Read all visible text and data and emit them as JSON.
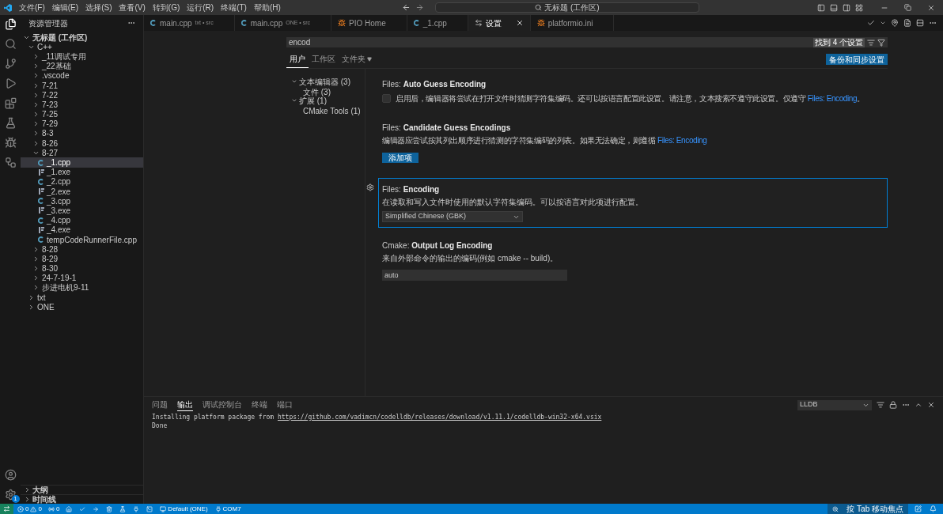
{
  "title_bar": {
    "menu": [
      "文件(F)",
      "编辑(E)",
      "选择(S)",
      "查看(V)",
      "转到(G)",
      "运行(R)",
      "终端(T)",
      "帮助(H)"
    ],
    "command_center": "无标题 (工作区)"
  },
  "activity_bar": {
    "settings_badge": "1"
  },
  "sidebar": {
    "title": "资源管理器",
    "tree": [
      {
        "label": "无标题 (工作区)",
        "kind": "workspace",
        "expanded": true,
        "selected": false,
        "children": [
          {
            "label": "C++",
            "kind": "folder",
            "expanded": true,
            "selected": false,
            "children": [
              {
                "label": "_11调试专用",
                "kind": "folder",
                "expanded": false,
                "selected": false
              },
              {
                "label": "_22基础",
                "kind": "folder",
                "expanded": false,
                "selected": false
              },
              {
                "label": ".vscode",
                "kind": "folder",
                "expanded": false,
                "selected": false
              },
              {
                "label": "7-21",
                "kind": "folder",
                "expanded": false,
                "selected": false
              },
              {
                "label": "7-22",
                "kind": "folder",
                "expanded": false,
                "selected": false
              },
              {
                "label": "7-23",
                "kind": "folder",
                "expanded": false,
                "selected": false
              },
              {
                "label": "7-25",
                "kind": "folder",
                "expanded": false,
                "selected": false
              },
              {
                "label": "7-29",
                "kind": "folder",
                "expanded": false,
                "selected": false
              },
              {
                "label": "8-3",
                "kind": "folder",
                "expanded": false,
                "selected": false
              },
              {
                "label": "8-26",
                "kind": "folder",
                "expanded": false,
                "selected": false
              },
              {
                "label": "8-27",
                "kind": "folder",
                "expanded": true,
                "selected": false,
                "children": [
                  {
                    "label": "_1.cpp",
                    "kind": "cpp",
                    "selected": true
                  },
                  {
                    "label": "_1.exe",
                    "kind": "exe",
                    "selected": false
                  },
                  {
                    "label": "_2.cpp",
                    "kind": "cpp",
                    "selected": false
                  },
                  {
                    "label": "_2.exe",
                    "kind": "exe",
                    "selected": false
                  },
                  {
                    "label": "_3.cpp",
                    "kind": "cpp",
                    "selected": false
                  },
                  {
                    "label": "_3.exe",
                    "kind": "exe",
                    "selected": false
                  },
                  {
                    "label": "_4.cpp",
                    "kind": "cpp",
                    "selected": false
                  },
                  {
                    "label": "_4.exe",
                    "kind": "exe",
                    "selected": false
                  },
                  {
                    "label": "tempCodeRunnerFile.cpp",
                    "kind": "cpp",
                    "selected": false
                  }
                ]
              },
              {
                "label": "8-28",
                "kind": "folder",
                "expanded": false,
                "selected": false
              },
              {
                "label": "8-29",
                "kind": "folder",
                "expanded": false,
                "selected": false
              },
              {
                "label": "8-30",
                "kind": "folder",
                "expanded": false,
                "selected": false
              },
              {
                "label": "24-7-19-1",
                "kind": "folder",
                "expanded": false,
                "selected": false
              },
              {
                "label": "步进电机9-11",
                "kind": "folder",
                "expanded": false,
                "selected": false
              }
            ]
          },
          {
            "label": "txt",
            "kind": "folder",
            "expanded": false,
            "selected": false
          },
          {
            "label": "ONE",
            "kind": "folder",
            "expanded": false,
            "selected": false
          }
        ]
      }
    ],
    "sections": [
      {
        "label": "大纲",
        "expanded": false
      },
      {
        "label": "时间线",
        "expanded": false
      }
    ]
  },
  "tabs": [
    {
      "label": "main.cpp",
      "description": "txt • src",
      "kind": "cpp",
      "selected": false
    },
    {
      "label": "main.cpp",
      "description": "ONE • src",
      "kind": "cpp",
      "selected": false
    },
    {
      "label": "PIO Home",
      "kind": "pio",
      "selected": false
    },
    {
      "label": "_1.cpp",
      "kind": "cpp",
      "selected": false
    },
    {
      "label": "设置",
      "kind": "settings",
      "selected": true
    },
    {
      "label": "platformio.ini",
      "kind": "pio",
      "selected": false
    }
  ],
  "settings": {
    "search": "encod",
    "result_count": "找到 4 个设置",
    "scopes": [
      {
        "label": "用户",
        "selected": true,
        "dropdown": false
      },
      {
        "label": "工作区",
        "selected": false,
        "dropdown": false
      },
      {
        "label": "文件夹",
        "selected": false,
        "dropdown": true
      }
    ],
    "sync_button": "备份和同步设置",
    "toc": [
      {
        "label": "文本编辑器 (3)",
        "expanded": true,
        "children": [
          {
            "label": "文件 (3)"
          }
        ]
      },
      {
        "label": "扩展 (1)",
        "expanded": true,
        "children": [
          {
            "label": "CMake Tools (1)"
          }
        ]
      }
    ],
    "items": [
      {
        "category": "Files: ",
        "name": "Auto Guess Encoding",
        "kind": "checkbox",
        "checked": false,
        "focused": false,
        "description": "启用后，编辑器将尝试在打开文件时猜测字符集编码。还可以按语言配置此设置。请注意，文本搜索不遵守此设置。仅遵守 ",
        "link": "Files: Encoding",
        "suffix": "。"
      },
      {
        "category": "Files: ",
        "name": "Candidate Guess Encodings",
        "kind": "list",
        "focused": false,
        "description": "编辑器应尝试按其列出顺序进行猜测的字符集编码的列表。如果无法确定，则遵循 ",
        "link": "Files: Encoding",
        "button": "添加项"
      },
      {
        "category": "Files: ",
        "name": "Encoding",
        "kind": "select",
        "focused": true,
        "description": "在读取和写入文件时使用的默认字符集编码。可以按语言对此项进行配置。",
        "value": "Simplified Chinese (GBK)"
      },
      {
        "category": "Cmake: ",
        "name": "Output Log Encoding",
        "kind": "text",
        "focused": false,
        "description": "来自外部命令的输出的编码(例如 cmake -- build)。",
        "value": "auto"
      }
    ]
  },
  "panel": {
    "tabs": [
      {
        "label": "问题",
        "selected": false
      },
      {
        "label": "输出",
        "selected": true
      },
      {
        "label": "调试控制台",
        "selected": false
      },
      {
        "label": "终端",
        "selected": false
      },
      {
        "label": "端口",
        "selected": false
      }
    ],
    "channel": "LLDB",
    "output": [
      {
        "text": "Installing platform package from ",
        "link": "https://github.com/vadimcn/codelldb/releases/download/v1.11.1/codelldb-win32-x64.vsix"
      },
      {
        "text": "Done"
      }
    ]
  },
  "status_bar": {
    "errors": "0",
    "warnings": "0",
    "ports": "0",
    "profile": "Default (ONE)",
    "port": "COM7",
    "focus_hint": "按 Tab 移动焦点"
  }
}
